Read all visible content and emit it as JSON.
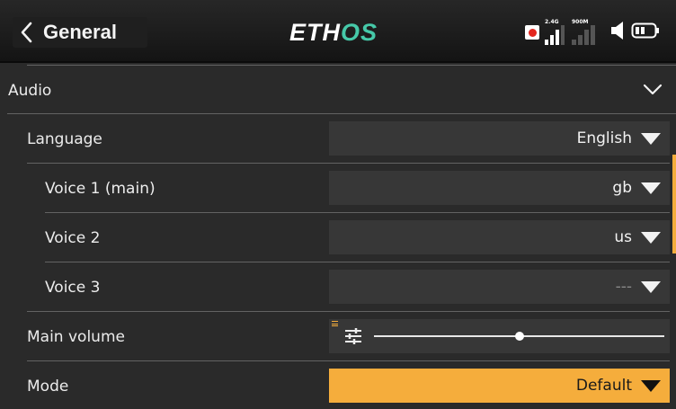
{
  "header": {
    "title": "General",
    "logo_main": "ETH",
    "logo_accent": "OS",
    "sig1_label": "2.4G",
    "sig2_label": "900M"
  },
  "audio": {
    "label": "Audio",
    "rows": {
      "language": {
        "label": "Language",
        "value": "English"
      },
      "voice1": {
        "label": "Voice 1 (main)",
        "value": "gb"
      },
      "voice2": {
        "label": "Voice 2",
        "value": "us"
      },
      "voice3": {
        "label": "Voice 3",
        "value": "---"
      },
      "volume": {
        "label": "Main volume",
        "level": 0.5
      },
      "mode": {
        "label": "Mode",
        "value": "Default"
      }
    }
  },
  "colors": {
    "accent": "#f5ad3c",
    "logo_accent": "#46c9a9",
    "background": "#2a2a2a",
    "field": "#373737",
    "record": "#e3261e"
  },
  "icons": [
    "chevron-left-icon",
    "record-icon",
    "signal-2g4-icon",
    "signal-900m-icon",
    "speaker-icon",
    "battery-icon",
    "chevron-down-icon",
    "dropdown-triangle-icon",
    "sliders-icon"
  ]
}
